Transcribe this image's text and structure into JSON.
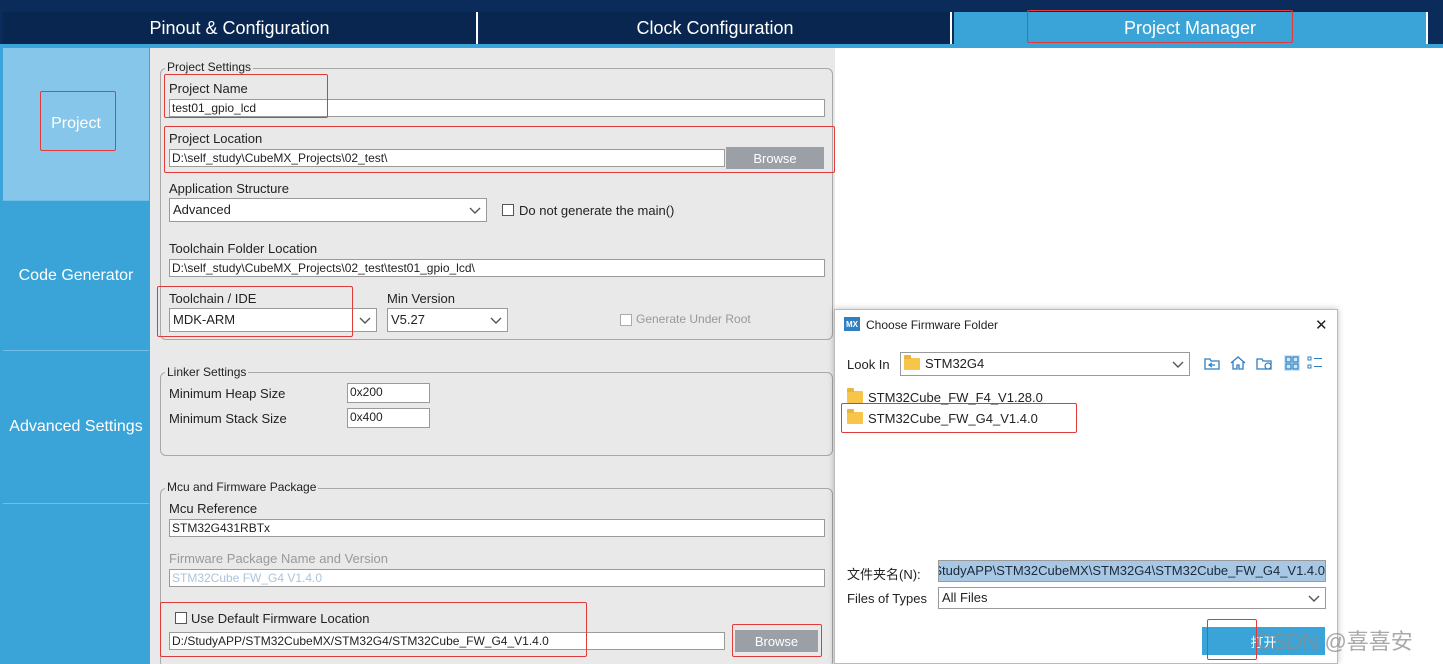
{
  "tabs": [
    "Pinout & Configuration",
    "Clock Configuration",
    "Project Manager"
  ],
  "nav": [
    "Project",
    "Code Generator",
    "Advanced Settings"
  ],
  "project_settings": {
    "legend": "Project Settings",
    "project_name_label": "Project Name",
    "project_name": "test01_gpio_lcd",
    "project_location_label": "Project Location",
    "project_location": "D:\\self_study\\CubeMX_Projects\\02_test\\",
    "browse": "Browse",
    "app_structure_label": "Application Structure",
    "app_structure": "Advanced",
    "no_main_label": "Do not generate the main()",
    "toolchain_folder_label": "Toolchain Folder Location",
    "toolchain_folder": "D:\\self_study\\CubeMX_Projects\\02_test\\test01_gpio_lcd\\",
    "toolchain_label": "Toolchain / IDE",
    "toolchain": "MDK-ARM",
    "min_version_label": "Min Version",
    "min_version": "V5.27",
    "gen_under_root": "Generate Under Root"
  },
  "linker": {
    "legend": "Linker Settings",
    "heap_label": "Minimum Heap Size",
    "heap": "0x200",
    "stack_label": "Minimum Stack Size",
    "stack": "0x400"
  },
  "mcu": {
    "legend": "Mcu and Firmware Package",
    "ref_label": "Mcu Reference",
    "ref": "STM32G431RBTx",
    "fw_label": "Firmware Package Name and Version",
    "fw": "STM32Cube FW_G4 V1.4.0",
    "use_default_label": "Use Default Firmware Location",
    "fw_location": "D:/StudyAPP/STM32CubeMX/STM32G4/STM32Cube_FW_G4_V1.4.0",
    "browse": "Browse"
  },
  "dialog": {
    "title": "Choose Firmware Folder",
    "logo": "MX",
    "close": "✕",
    "look_in_label": "Look In",
    "look_in": "STM32G4",
    "items": [
      "STM32Cube_FW_F4_V1.28.0",
      "STM32Cube_FW_G4_V1.4.0"
    ],
    "folder_name_label": "文件夹名(N):",
    "folder_name": "StudyAPP\\STM32CubeMX\\STM32G4\\STM32Cube_FW_G4_V1.4.0",
    "files_of_types_label": "Files of Types",
    "files_of_types": "All Files",
    "open": "打开"
  },
  "watermark": "CSDN @喜喜安",
  "colors": {
    "tab_active": "#3aa3d8",
    "tab_dark": "#08264f",
    "highlight": "#e03a3a"
  }
}
